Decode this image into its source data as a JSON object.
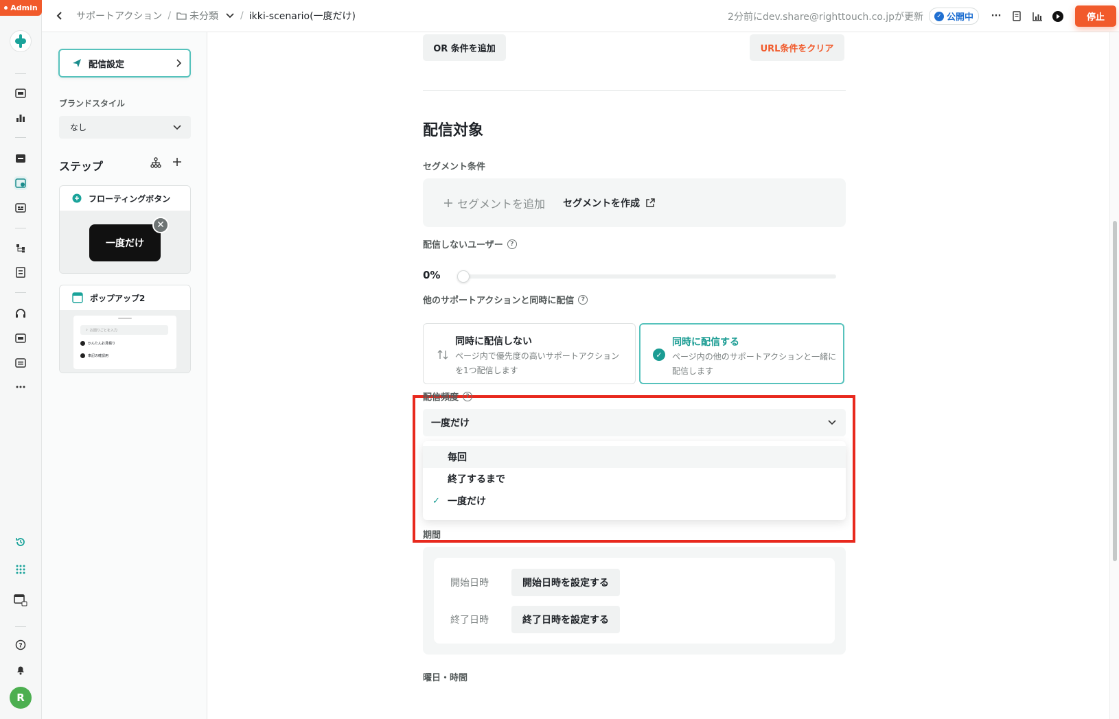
{
  "admin_badge": "Admin",
  "breadcrumb": {
    "root": "サポートアクション",
    "folder": "未分類",
    "current": "ikki-scenario(一度だけ)"
  },
  "header": {
    "updated_text": "2分前にdev.share@righttouch.co.jpが更新",
    "status": "公開中",
    "stop_label": "停止",
    "more_label": "···"
  },
  "sidebar": {
    "delivery_settings": "配信設定",
    "brand_style_label": "ブランドスタイル",
    "brand_style_value": "なし",
    "steps_title": "ステップ",
    "steps": [
      {
        "title": "フローティングボタン",
        "preview_text": "一度だけ"
      },
      {
        "title": "ポップアップ2",
        "preview_search": "お困りごとを入力",
        "preview_items": [
          "かんたんお見積り",
          "車記の確認用"
        ]
      }
    ]
  },
  "main": {
    "or_condition": "OR 条件を追加",
    "clear_url": "URL条件をクリア",
    "target_title": "配信対象",
    "segment_label": "セグメント条件",
    "add_segment": "セグメントを追加",
    "create_segment": "セグメントを作成",
    "exclude_label": "配信しないユーザー",
    "exclude_value": "0%",
    "concurrent_label": "他のサポートアクションと同時に配信",
    "options": [
      {
        "title": "同時に配信しない",
        "desc": "ページ内で優先度の高いサポートアクションを1つ配信します"
      },
      {
        "title": "同時に配信する",
        "desc": "ページ内の他のサポートアクションと一緒に配信します"
      }
    ],
    "frequency_label": "配信頻度",
    "frequency_value": "一度だけ",
    "frequency_options": [
      "毎回",
      "終了するまで",
      "一度だけ"
    ],
    "period_label": "期間",
    "start_label": "開始日時",
    "start_button": "開始日時を設定する",
    "end_label": "終了日時",
    "end_button": "終了日時を設定する",
    "weekday_label": "曜日・時間"
  },
  "user": {
    "initial": "R"
  },
  "colors": {
    "accent": "#1a9c93",
    "brand": "#f15a2b",
    "highlight": "#e8291e"
  }
}
